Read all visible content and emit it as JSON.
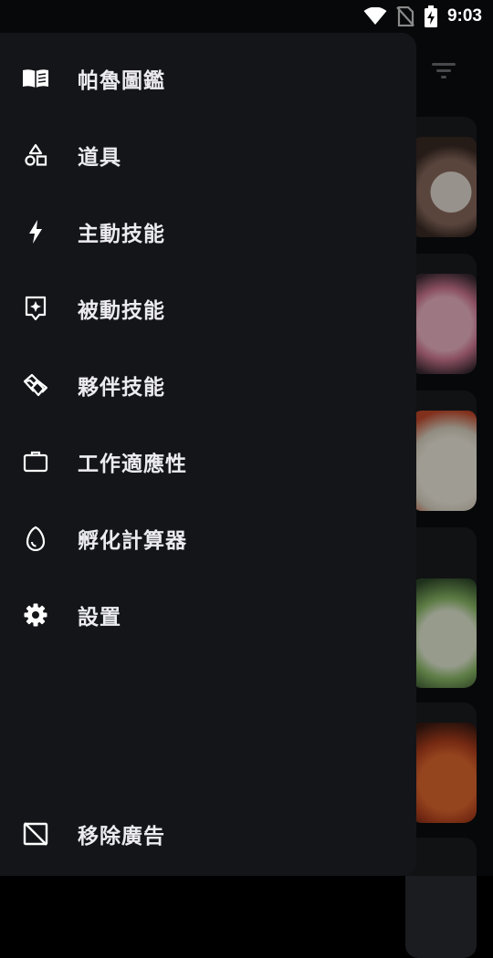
{
  "status_bar": {
    "time": "9:03",
    "icons": [
      "wifi-icon",
      "no-sim-icon",
      "battery-charging-icon"
    ]
  },
  "background": {
    "filter_icon": "filter-icon"
  },
  "drawer": {
    "items": [
      {
        "label": "帕魯圖鑑",
        "icon": "book-icon"
      },
      {
        "label": "道具",
        "icon": "shapes-icon"
      },
      {
        "label": "主動技能",
        "icon": "bolt-icon"
      },
      {
        "label": "被動技能",
        "icon": "sparkle-box-icon"
      },
      {
        "label": "夥伴技能",
        "icon": "handshake-icon"
      },
      {
        "label": "工作適應性",
        "icon": "briefcase-icon"
      },
      {
        "label": "孵化計算器",
        "icon": "egg-icon"
      },
      {
        "label": "設置",
        "icon": "gear-icon"
      }
    ],
    "footer_item": {
      "label": "移除廣告",
      "icon": "ad-off-icon"
    }
  }
}
